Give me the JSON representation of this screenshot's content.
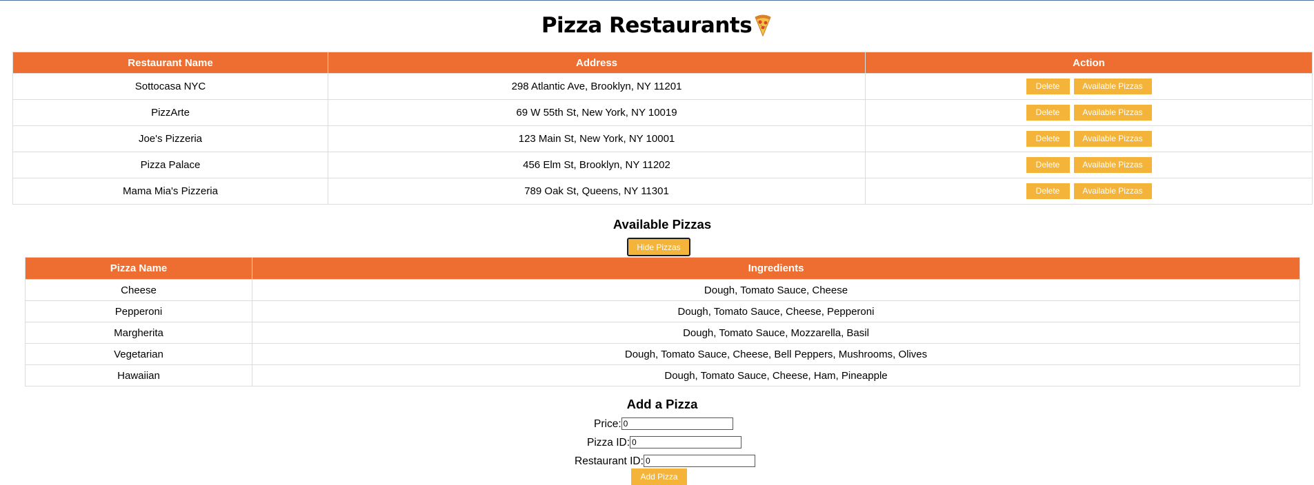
{
  "page": {
    "title": "Pizza Restaurants"
  },
  "icons": {
    "title_icon": "pizza-slice-icon"
  },
  "colors": {
    "header_bg": "#ee6e31",
    "button_bg": "#f4b43a",
    "button_text": "#ffffff"
  },
  "restaurants": {
    "columns": [
      "Restaurant Name",
      "Address",
      "Action"
    ],
    "delete_label": "Delete",
    "available_label": "Available Pizzas",
    "rows": [
      {
        "name": "Sottocasa NYC",
        "address": "298 Atlantic Ave, Brooklyn, NY 11201"
      },
      {
        "name": "PizzArte",
        "address": "69 W 55th St, New York, NY 10019"
      },
      {
        "name": "Joe's Pizzeria",
        "address": "123 Main St, New York, NY 10001"
      },
      {
        "name": "Pizza Palace",
        "address": "456 Elm St, Brooklyn, NY 11202"
      },
      {
        "name": "Mama Mia's Pizzeria",
        "address": "789 Oak St, Queens, NY 11301"
      }
    ]
  },
  "pizzas": {
    "heading": "Available Pizzas",
    "hide_label": "Hide Pizzas",
    "columns": [
      "Pizza Name",
      "Ingredients"
    ],
    "rows": [
      {
        "name": "Cheese",
        "ingredients": "Dough, Tomato Sauce, Cheese"
      },
      {
        "name": "Pepperoni",
        "ingredients": "Dough, Tomato Sauce, Cheese, Pepperoni"
      },
      {
        "name": "Margherita",
        "ingredients": "Dough, Tomato Sauce, Mozzarella, Basil"
      },
      {
        "name": "Vegetarian",
        "ingredients": "Dough, Tomato Sauce, Cheese, Bell Peppers, Mushrooms, Olives"
      },
      {
        "name": "Hawaiian",
        "ingredients": "Dough, Tomato Sauce, Cheese, Ham, Pineapple"
      }
    ]
  },
  "add_form": {
    "heading": "Add a Pizza",
    "price_label": "Price:",
    "price_value": "0",
    "pizza_id_label": "Pizza ID:",
    "pizza_id_value": "0",
    "restaurant_id_label": "Restaurant ID:",
    "restaurant_id_value": "0",
    "submit_label": "Add Pizza"
  }
}
